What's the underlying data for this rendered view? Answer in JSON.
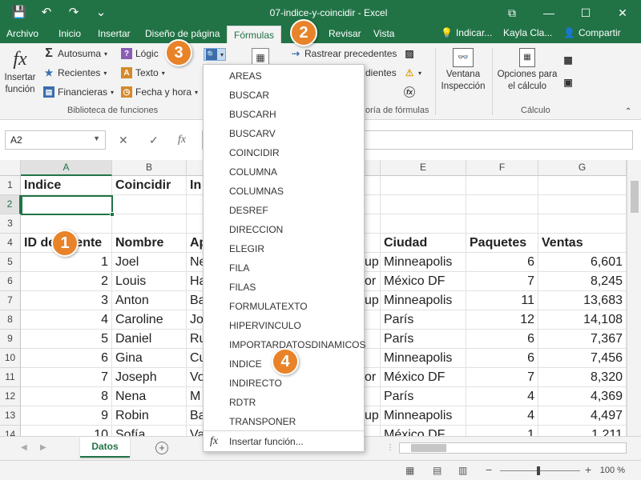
{
  "titlebar": {
    "doc_title": "07-indice-y-coincidir  -  Excel",
    "qat": {
      "save": "💾",
      "undo": "↶",
      "redo": "↷",
      "more": "⌄"
    },
    "min": "—",
    "max": "☐",
    "close": "✕",
    "restore_icon": "⧉"
  },
  "tabs": {
    "items": [
      "Archivo",
      "Inicio",
      "Insertar",
      "Diseño de página",
      "Fórmulas",
      "Revisar",
      "Vista"
    ],
    "active": "Fórmulas",
    "indicar": "Indicar...",
    "user": "Kayla Cla...",
    "share": "Compartir"
  },
  "ribbon": {
    "insertar_funcion": "Insertar función",
    "autosuma": "Autosuma",
    "recientes": "Recientes",
    "financieras": "Financieras",
    "logicas": "Lógic",
    "texto": "Texto",
    "fecha_hora": "Fecha y hora",
    "biblioteca_label": "Biblioteca de funciones",
    "rastrear_precedentes": "Rastrear precedentes",
    "dientes": "dientes",
    "auditoria_label": "oría de fórmulas",
    "ventana_inspeccion": "Ventana Inspección",
    "opciones_calculo": "Opciones para el cálculo",
    "calculo_label": "Cálculo"
  },
  "formula_bar": {
    "name_box": "A2",
    "cancel": "✕",
    "enter": "✓",
    "fx": "fx",
    "formula": ""
  },
  "columns": [
    "A",
    "B",
    "C",
    "D",
    "E",
    "F",
    "G"
  ],
  "rows": [
    {
      "n": "1",
      "A": "Indice",
      "B": "Coincidir",
      "C": "In",
      "E": "",
      "F": "",
      "G": ""
    },
    {
      "n": "2",
      "A": "",
      "B": "",
      "C": "",
      "E": "",
      "F": "",
      "G": ""
    },
    {
      "n": "3",
      "A": "",
      "B": "",
      "C": "",
      "E": "",
      "F": "",
      "G": ""
    },
    {
      "n": "4",
      "A": "ID de Agente",
      "B": "Nombre",
      "C": "Ap",
      "E": "Ciudad",
      "F": "Paquetes",
      "G": "Ventas"
    },
    {
      "n": "5",
      "A": "1",
      "B": "Joel",
      "C": "Ne",
      "D": "up",
      "E": "Minneapolis",
      "F": "6",
      "G": "6,601"
    },
    {
      "n": "6",
      "A": "2",
      "B": "Louis",
      "C": "Ha",
      "D": "or",
      "E": "México DF",
      "F": "7",
      "G": "8,245"
    },
    {
      "n": "7",
      "A": "3",
      "B": "Anton",
      "C": "Ba",
      "D": "up",
      "E": "Minneapolis",
      "F": "11",
      "G": "13,683"
    },
    {
      "n": "8",
      "A": "4",
      "B": "Caroline",
      "C": "Jo",
      "D": "",
      "E": "París",
      "F": "12",
      "G": "14,108"
    },
    {
      "n": "9",
      "A": "5",
      "B": "Daniel",
      "C": "Ru",
      "D": "",
      "E": "París",
      "F": "6",
      "G": "7,367"
    },
    {
      "n": "10",
      "A": "6",
      "B": "Gina",
      "C": "Cu",
      "D": "",
      "E": "Minneapolis",
      "F": "6",
      "G": "7,456"
    },
    {
      "n": "11",
      "A": "7",
      "B": "Joseph",
      "C": "Vo",
      "D": "or",
      "E": "México DF",
      "F": "7",
      "G": "8,320"
    },
    {
      "n": "12",
      "A": "8",
      "B": "Nena",
      "C": "M",
      "D": "",
      "E": "París",
      "F": "4",
      "G": "4,369"
    },
    {
      "n": "13",
      "A": "9",
      "B": "Robin",
      "C": "Ba",
      "D": "up",
      "E": "Minneapolis",
      "F": "4",
      "G": "4,497"
    },
    {
      "n": "14",
      "A": "10",
      "B": "Sofía",
      "C": "Va",
      "D": "",
      "E": "México DF",
      "F": "1",
      "G": "1,211"
    }
  ],
  "menu": {
    "items": [
      "AREAS",
      "BUSCAR",
      "BUSCARH",
      "BUSCARV",
      "COINCIDIR",
      "COLUMNA",
      "COLUMNAS",
      "DESREF",
      "DIRECCION",
      "ELEGIR",
      "FILA",
      "FILAS",
      "FORMULATEXTO",
      "HIPERVINCULO",
      "IMPORTARDATOSDINAMICOS",
      "INDICE",
      "INDIRECTO",
      "RDTR",
      "TRANSPONER"
    ],
    "footer": "Insertar función...",
    "footer_icon": "fx"
  },
  "sheet": {
    "tab": "Datos",
    "add": "+",
    "nav_prev": "◀",
    "nav_next": "▶",
    "more": "⋮"
  },
  "status": {
    "zoom": "100 %",
    "zoom_level": 1.0,
    "minus": "−",
    "plus": "+"
  },
  "callouts": [
    "1",
    "2",
    "3",
    "4"
  ],
  "colors": {
    "excel_green": "#217346",
    "callout_orange": "#e8832a"
  }
}
